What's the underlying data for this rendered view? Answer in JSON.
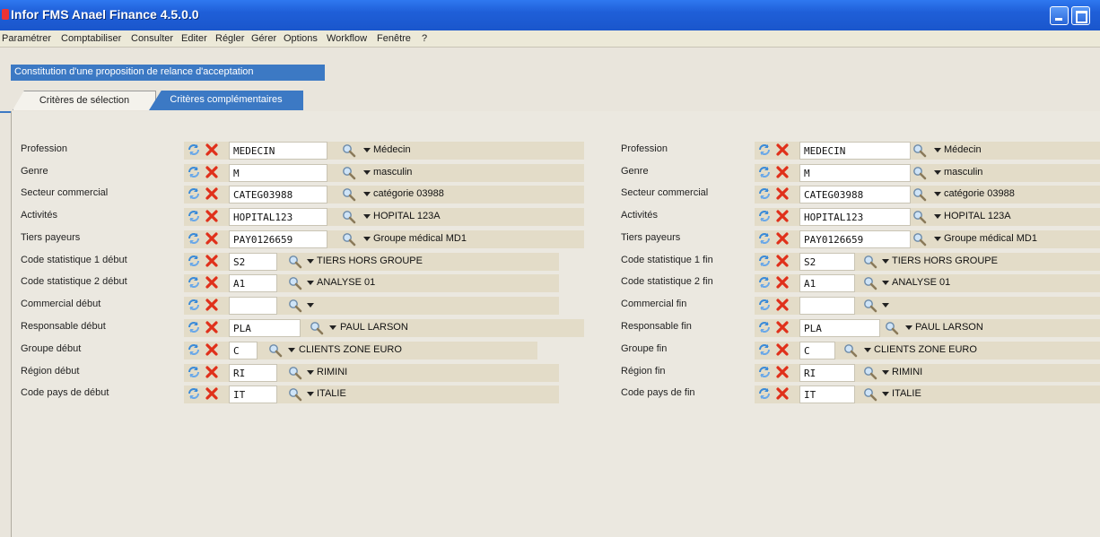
{
  "app": {
    "title": "Infor FMS Anael Finance 4.5.0.0"
  },
  "menu": [
    "Paramétrer",
    "Comptabiliser",
    "Consulter",
    "Editer",
    "Régler",
    "Gérer",
    "Options",
    "Workflow",
    "Fenêtre",
    "?"
  ],
  "window": {
    "caption": "Constitution d'une proposition de relance d'acceptation"
  },
  "tabs": [
    {
      "label": "Critères de sélection",
      "active": false
    },
    {
      "label": "Critères complémentaires",
      "active": true
    }
  ],
  "left": [
    {
      "label": "Profession",
      "code": "MEDECIN",
      "desc": "Médecin"
    },
    {
      "label": "Genre",
      "code": "M",
      "desc": "masculin"
    },
    {
      "label": "Secteur commercial",
      "code": "CATEG03988",
      "desc": "catégorie 03988"
    },
    {
      "label": "Activités",
      "code": "HOPITAL123",
      "desc": "HOPITAL 123A"
    },
    {
      "label": "Tiers payeurs",
      "code": "PAY0126659",
      "desc": "Groupe médical MD1"
    },
    {
      "label": "Code statistique 1 début",
      "code": "S2",
      "desc": "TIERS HORS GROUPE"
    },
    {
      "label": "Code statistique 2 début",
      "code": "A1",
      "desc": "ANALYSE 01"
    },
    {
      "label": "Commercial début",
      "code": "",
      "desc": ""
    },
    {
      "label": "Responsable début",
      "code": "PLA",
      "desc": "PAUL LARSON"
    },
    {
      "label": "Groupe début",
      "code": "C",
      "desc": "CLIENTS ZONE EURO"
    },
    {
      "label": "Région début",
      "code": "RI",
      "desc": "RIMINI"
    },
    {
      "label": "Code pays de début",
      "code": "IT",
      "desc": "ITALIE"
    }
  ],
  "right": [
    {
      "label": "Profession",
      "code": "MEDECIN",
      "desc": "Médecin"
    },
    {
      "label": "Genre",
      "code": "M",
      "desc": "masculin"
    },
    {
      "label": "Secteur commercial",
      "code": "CATEG03988",
      "desc": "catégorie 03988"
    },
    {
      "label": "Activités",
      "code": "HOPITAL123",
      "desc": "HOPITAL 123A"
    },
    {
      "label": "Tiers payeurs",
      "code": "PAY0126659",
      "desc": "Groupe médical MD1"
    },
    {
      "label": "Code statistique 1 fin",
      "code": "S2",
      "desc": "TIERS HORS GROUPE"
    },
    {
      "label": "Code statistique 2 fin",
      "code": "A1",
      "desc": "ANALYSE 01"
    },
    {
      "label": "Commercial fin",
      "code": "",
      "desc": ""
    },
    {
      "label": "Responsable fin",
      "code": "PLA",
      "desc": "PAUL LARSON"
    },
    {
      "label": "Groupe fin",
      "code": "C",
      "desc": "CLIENTS ZONE EURO"
    },
    {
      "label": "Région fin",
      "code": "RI",
      "desc": "RIMINI"
    },
    {
      "label": "Code pays de fin",
      "code": "IT",
      "desc": "ITALIE"
    }
  ],
  "colors": {
    "titlebar": "#1f5fd8",
    "tab_active": "#3c79c4",
    "field_band": "#e3dcc8",
    "delete_icon": "#e0301a",
    "refresh_icon": "#3a8ad8"
  },
  "icons": {
    "refresh": "refresh-icon",
    "delete": "delete-icon",
    "search": "search-icon",
    "dropdown": "dropdown-arrow-icon"
  }
}
